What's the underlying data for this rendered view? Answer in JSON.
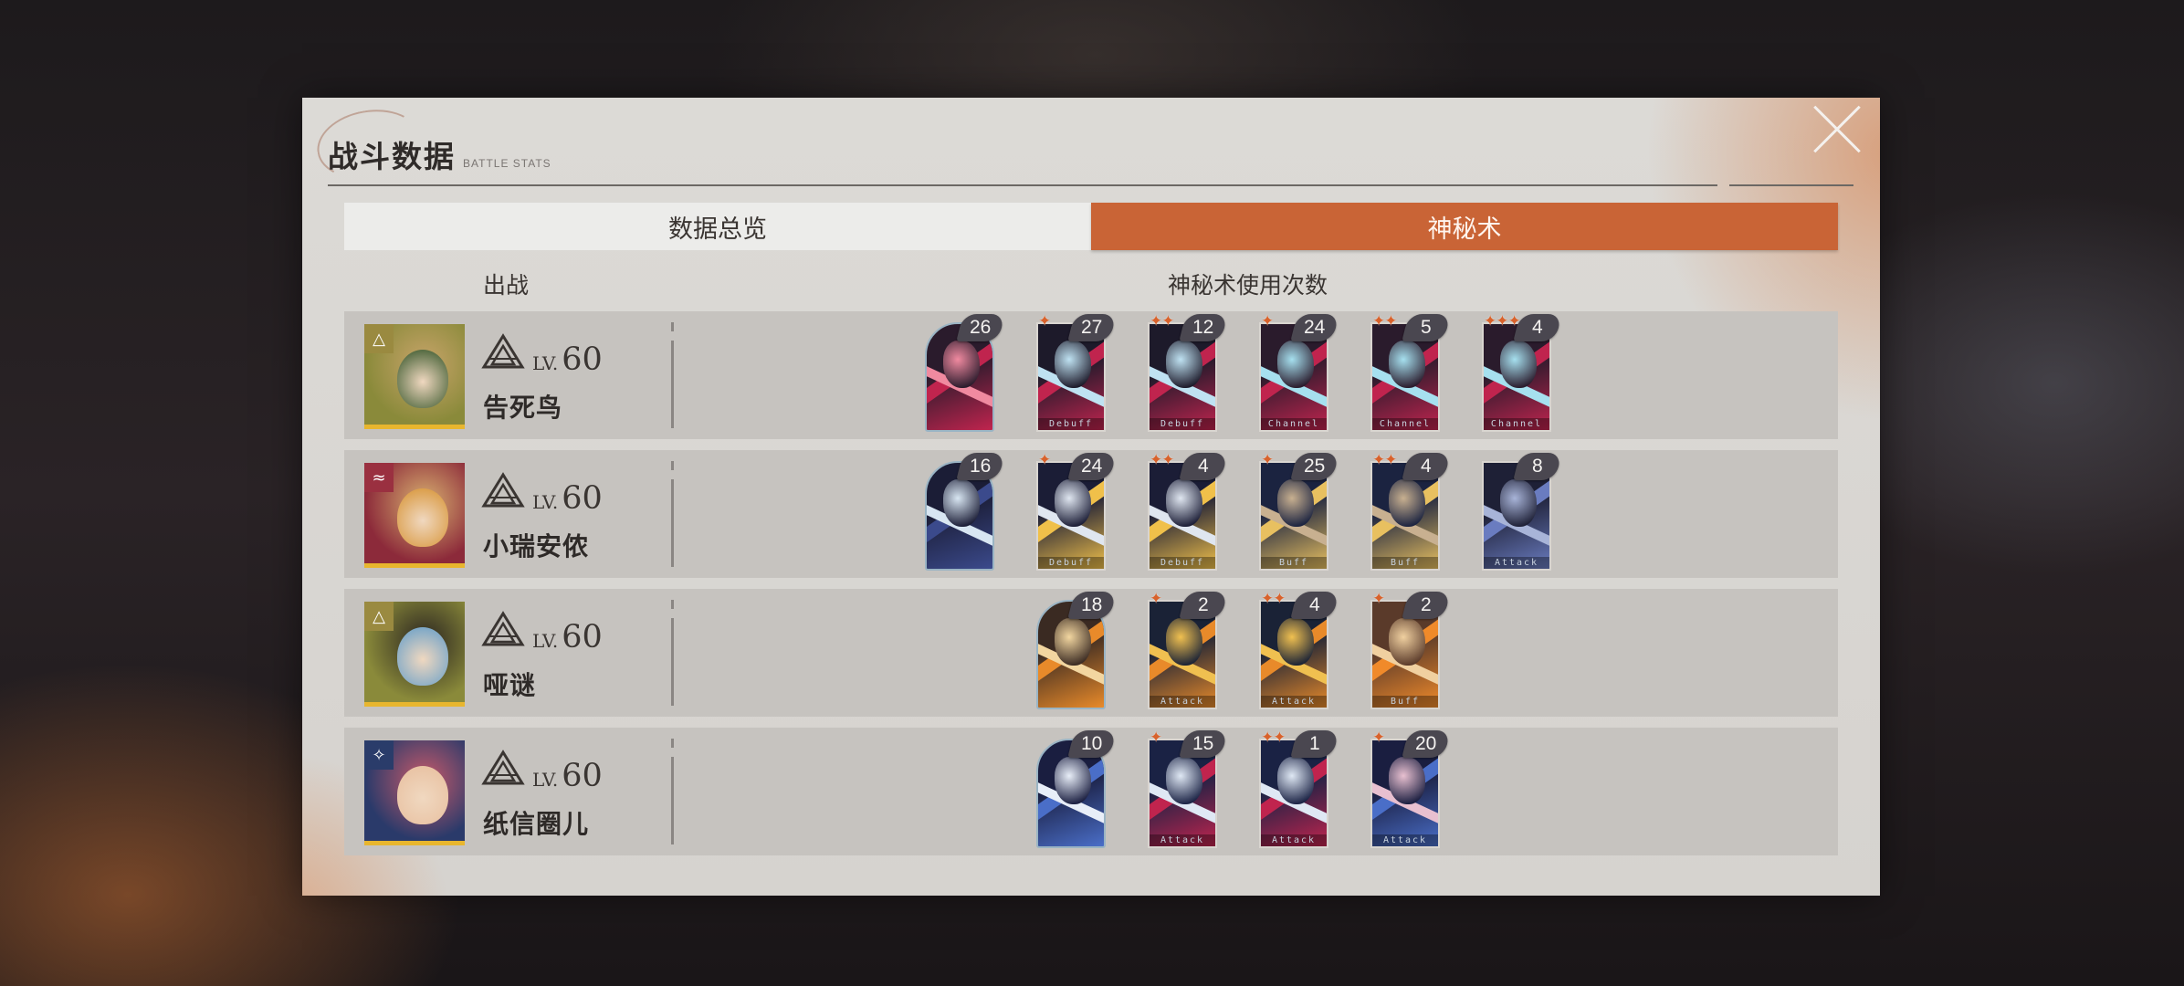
{
  "header": {
    "title": "战斗数据",
    "subtitle": "BATTLE STATS"
  },
  "tabs": [
    {
      "label": "数据总览",
      "active": false
    },
    {
      "label": "神秘术",
      "active": true
    }
  ],
  "columns": {
    "deployed": "出战",
    "usage": "神秘术使用次数"
  },
  "colors": {
    "accent": "#c96436",
    "star": "#d8622c",
    "badge": "#4a4750"
  },
  "characters": [
    {
      "name": "告死鸟",
      "lv_label": "LV.",
      "level": "60",
      "role_icon": "triangle-icon",
      "cards": [
        {
          "stars": "",
          "count": "26",
          "arch": true,
          "tag": "",
          "palette": [
            "#c0244e",
            "#2a1b2c",
            "#f08aa0"
          ]
        },
        {
          "stars": "✦",
          "count": "27",
          "arch": false,
          "tag": "Debuff",
          "palette": [
            "#c0244e",
            "#1d1a2a",
            "#bfe2f2"
          ]
        },
        {
          "stars": "✦✦",
          "count": "12",
          "arch": false,
          "tag": "Debuff",
          "palette": [
            "#c0244e",
            "#1d1a2a",
            "#bfe2f2"
          ]
        },
        {
          "stars": "✦",
          "count": "24",
          "arch": false,
          "tag": "Channel",
          "palette": [
            "#c0244e",
            "#2a1b2c",
            "#a6e0ef"
          ]
        },
        {
          "stars": "✦✦",
          "count": "5",
          "arch": false,
          "tag": "Channel",
          "palette": [
            "#c0244e",
            "#2a1b2c",
            "#a6e0ef"
          ]
        },
        {
          "stars": "✦✦✦",
          "count": "4",
          "arch": false,
          "tag": "Channel",
          "palette": [
            "#c0244e",
            "#2a1b2c",
            "#a6e0ef"
          ]
        }
      ]
    },
    {
      "name": "小瑞安侬",
      "lv_label": "LV.",
      "level": "60",
      "role_icon": "claw-icon",
      "cards": [
        {
          "stars": "",
          "count": "16",
          "arch": true,
          "tag": "",
          "palette": [
            "#3b4a8c",
            "#1b1d36",
            "#d8e6f2"
          ]
        },
        {
          "stars": "✦",
          "count": "24",
          "arch": false,
          "tag": "Debuff",
          "palette": [
            "#f0c04a",
            "#1b1d36",
            "#dfe6f0"
          ]
        },
        {
          "stars": "✦✦",
          "count": "4",
          "arch": false,
          "tag": "Debuff",
          "palette": [
            "#f0c04a",
            "#1b1d36",
            "#dfe6f0"
          ]
        },
        {
          "stars": "✦",
          "count": "25",
          "arch": false,
          "tag": "Buff",
          "palette": [
            "#e8c060",
            "#1b2340",
            "#c8b090"
          ]
        },
        {
          "stars": "✦✦",
          "count": "4",
          "arch": false,
          "tag": "Buff",
          "palette": [
            "#e8c060",
            "#1b2340",
            "#c8b090"
          ]
        },
        {
          "stars": "",
          "count": "8",
          "arch": false,
          "tag": "Attack",
          "palette": [
            "#6a7cc0",
            "#1e2036",
            "#a8b4d8"
          ]
        }
      ]
    },
    {
      "name": "哑谜",
      "lv_label": "LV.",
      "level": "60",
      "role_icon": "triangle-icon",
      "cards": [
        {
          "stars": "",
          "count": "18",
          "arch": true,
          "tag": "",
          "palette": [
            "#e88a2a",
            "#3a2a22",
            "#f2d6a0"
          ]
        },
        {
          "stars": "✦",
          "count": "2",
          "arch": false,
          "tag": "Attack",
          "palette": [
            "#e88a2a",
            "#1a2236",
            "#f0c050"
          ]
        },
        {
          "stars": "✦✦",
          "count": "4",
          "arch": false,
          "tag": "Attack",
          "palette": [
            "#e88a2a",
            "#1a2236",
            "#f0c050"
          ]
        },
        {
          "stars": "✦",
          "count": "2",
          "arch": false,
          "tag": "Buff",
          "palette": [
            "#f08a2a",
            "#5a3a2a",
            "#f0d0a0"
          ]
        }
      ]
    },
    {
      "name": "纸信圈儿",
      "lv_label": "LV.",
      "level": "60",
      "role_icon": "star-icon",
      "cards": [
        {
          "stars": "",
          "count": "10",
          "arch": true,
          "tag": "",
          "palette": [
            "#4a6ec8",
            "#1a1e40",
            "#e8eef8"
          ]
        },
        {
          "stars": "✦",
          "count": "15",
          "arch": false,
          "tag": "Attack",
          "palette": [
            "#c0244e",
            "#1a2244",
            "#dfe8f4"
          ]
        },
        {
          "stars": "✦✦",
          "count": "1",
          "arch": false,
          "tag": "Attack",
          "palette": [
            "#c0244e",
            "#1a2244",
            "#dfe8f4"
          ]
        },
        {
          "stars": "✦",
          "count": "20",
          "arch": false,
          "tag": "Attack",
          "palette": [
            "#4a6ec8",
            "#1a1e40",
            "#e8c0d0"
          ]
        }
      ]
    }
  ]
}
